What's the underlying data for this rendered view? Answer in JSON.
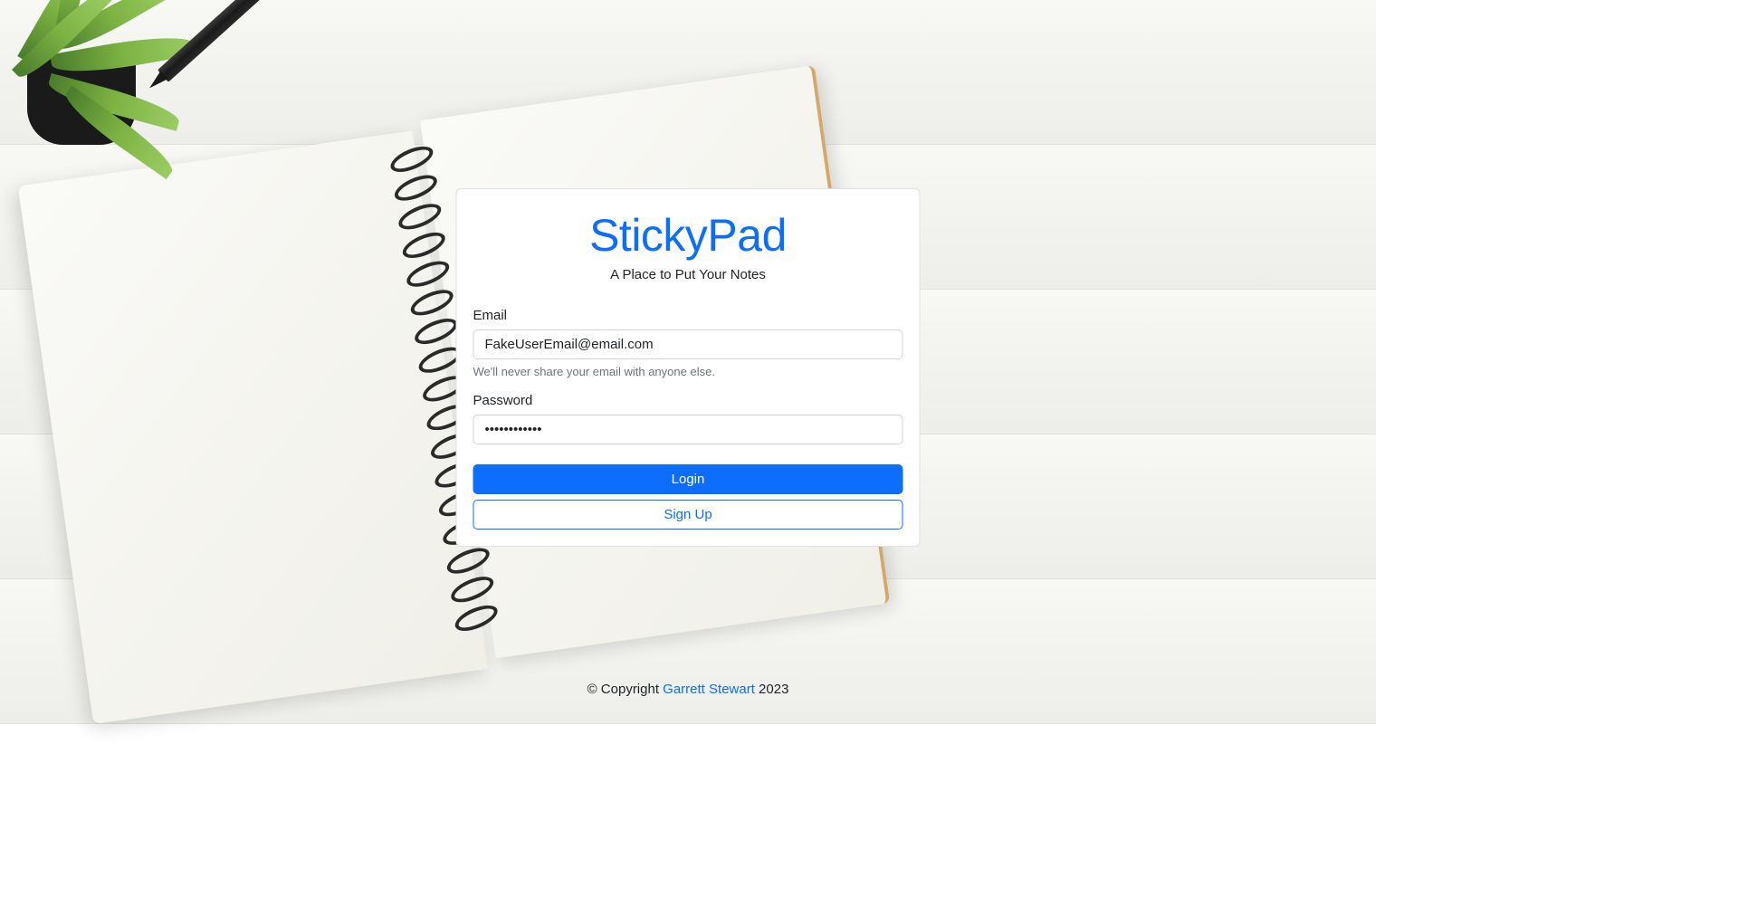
{
  "app": {
    "title": "StickyPad",
    "subtitle": "A Place to Put Your Notes"
  },
  "form": {
    "email_label": "Email",
    "email_value": "FakeUserEmail@email.com",
    "email_help": "We'll never share your email with anyone else.",
    "password_label": "Password",
    "password_value": "••••••••••••",
    "login_button": "Login",
    "signup_button": "Sign Up"
  },
  "footer": {
    "copyright_prefix": "© Copyright ",
    "author": "Garrett Stewart",
    "year": " 2023"
  }
}
